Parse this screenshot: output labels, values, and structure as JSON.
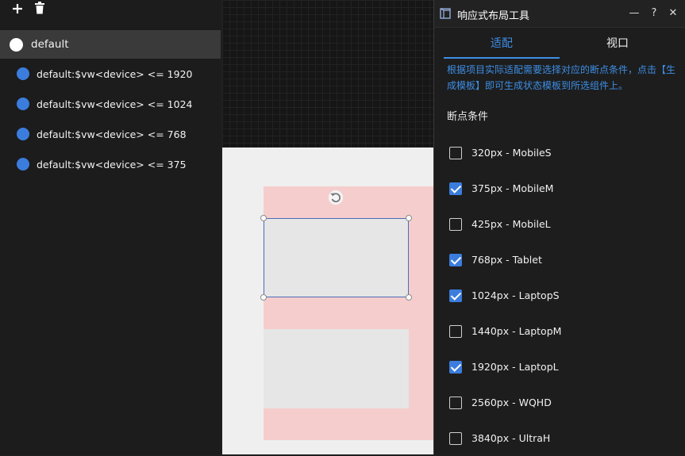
{
  "left_panel": {
    "toolbar": {
      "add_icon": "plus-icon",
      "delete_icon": "trash-icon"
    },
    "states": [
      {
        "label": "default",
        "active": true
      },
      {
        "label": "default:$vw<device> <= 1920",
        "active": false
      },
      {
        "label": "default:$vw<device> <= 1024",
        "active": false
      },
      {
        "label": "default:$vw<device> <= 768",
        "active": false
      },
      {
        "label": "default:$vw<device> <= 375",
        "active": false
      }
    ]
  },
  "panel": {
    "title": "响应式布局工具",
    "window_buttons": {
      "minimize": "—",
      "help": "?",
      "close": "✕"
    },
    "tabs": [
      {
        "label": "适配",
        "active": true
      },
      {
        "label": "视口",
        "active": false
      }
    ],
    "description": "根据项目实际适配需要选择对应的断点条件，点击【生成模板】即可生成状态模板到所选组件上。",
    "section_title": "断点条件",
    "breakpoints": [
      {
        "label": "320px - MobileS",
        "checked": false
      },
      {
        "label": "375px - MobileM",
        "checked": true
      },
      {
        "label": "425px - MobileL",
        "checked": false
      },
      {
        "label": "768px - Tablet",
        "checked": true
      },
      {
        "label": "1024px - LaptopS",
        "checked": true
      },
      {
        "label": "1440px - LaptopM",
        "checked": false
      },
      {
        "label": "1920px - LaptopL",
        "checked": true
      },
      {
        "label": "2560px - WQHD",
        "checked": false
      },
      {
        "label": "3840px - UltraH",
        "checked": false
      }
    ]
  },
  "colors": {
    "accent": "#3d8ee6",
    "checkbox_on": "#3b7ddd",
    "selection_pink": "#f6cdcd"
  }
}
